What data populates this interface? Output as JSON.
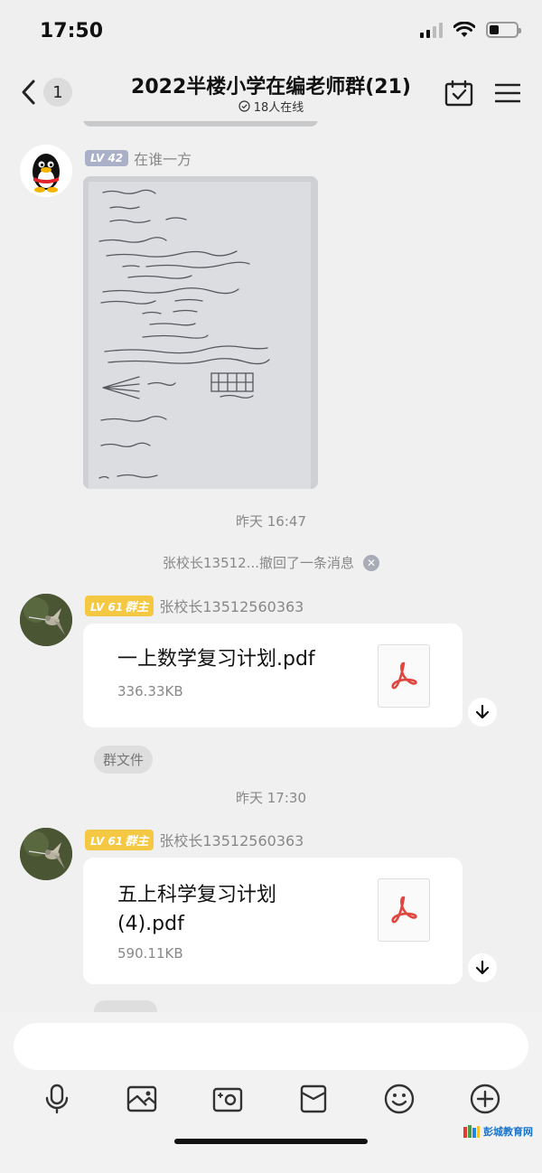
{
  "status_bar": {
    "time": "17:50"
  },
  "nav": {
    "back_count": "1",
    "title": "2022半楼小学在编老师群(21)",
    "online_text": "18人在线"
  },
  "messages": {
    "photo_msg": {
      "level": "LV 42",
      "sender": "在谁一方"
    },
    "time_1": "昨天 16:47",
    "recall_text": "张校长13512...撤回了一条消息",
    "file_msg_1": {
      "level": "LV 61",
      "role": "群主",
      "sender": "张校长13512560363",
      "file_name": "一上数学复习计划.pdf",
      "file_size": "336.33KB",
      "tag": "群文件"
    },
    "time_2": "昨天 17:30",
    "file_msg_2": {
      "level": "LV 61",
      "role": "群主",
      "sender": "张校长13512560363",
      "file_name_line1": "五上科学复习计划",
      "file_name_line2": "(4).pdf",
      "file_size": "590.11KB"
    }
  },
  "toolbar": {
    "icons": [
      "microphone-icon",
      "image-icon",
      "camera-icon",
      "red-packet-icon",
      "emoji-icon",
      "plus-icon"
    ]
  },
  "watermark": {
    "text": "彭城教育网"
  },
  "colors": {
    "background": "#f0f0f0",
    "gold_badge": "#f5c844",
    "grey_badge": "#a9b0c8",
    "pdf_red": "#e0463d"
  }
}
